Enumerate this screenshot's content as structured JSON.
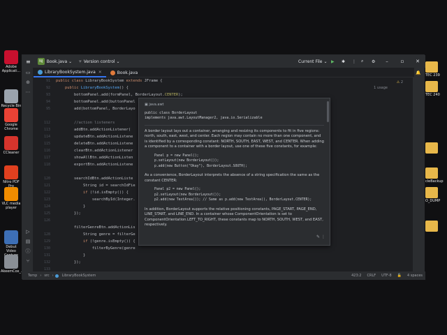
{
  "desktop": {
    "left_icons": [
      {
        "label": "Adobe Applicati...",
        "color": "#c8102e",
        "icon": "adobe-icon"
      },
      {
        "label": "Recycle Bin",
        "color": "#9aa3ad",
        "icon": "recycle-bin-icon"
      },
      {
        "label": "Google Chrome",
        "color": "#e94235",
        "icon": "chrome-icon"
      },
      {
        "label": "CCleaner",
        "color": "#d6342c",
        "icon": "ccleaner-icon"
      },
      {
        "label": "Nitro PDF Pro",
        "color": "#e0401f",
        "icon": "nitro-pdf-icon"
      },
      {
        "label": "VLC media player",
        "color": "#f08c00",
        "icon": "vlc-icon"
      },
      {
        "label": "Debut Video Capture So...",
        "color": "#3d6fb6",
        "icon": "debut-video-icon"
      },
      {
        "label": "AkeemCox_...",
        "color": "#8a8f96",
        "icon": "file-icon"
      }
    ],
    "right_icons": [
      {
        "label": "TEC 239"
      },
      {
        "label": "TEC 240"
      },
      {
        "label": ""
      },
      {
        "label": "cleBackup"
      },
      {
        "label": "O_DUMP"
      },
      {
        "label": ""
      }
    ]
  },
  "ide": {
    "project": "Book.java",
    "project_badge": "NJ",
    "menu_label": "Version control",
    "run_config": "Current File",
    "tabs": [
      {
        "label": "LibraryBookSystem.java",
        "active": true
      },
      {
        "label": "Book.java",
        "active": false
      }
    ],
    "usages_hint": "1 usage",
    "warnings": "2",
    "line_numbers": [
      "91",
      "92",
      "93",
      "94",
      "95",
      "",
      "112",
      "113",
      "114",
      "115",
      "116",
      "117",
      "118",
      "",
      "120",
      "121",
      "122",
      "123",
      "124",
      "125",
      "126",
      "",
      "128",
      "129",
      "130",
      "131",
      "132",
      "133",
      "134",
      "",
      "147"
    ],
    "code_lines": [
      {
        "segments": [
          {
            "t": "public class ",
            "c": "kw"
          },
          {
            "t": "LibraryBookSystem ",
            "c": ""
          },
          {
            "t": "extends ",
            "c": "kw"
          },
          {
            "t": "JFrame {",
            "c": ""
          }
        ]
      },
      {
        "segments": [
          {
            "t": "    public ",
            "c": "kw"
          },
          {
            "t": "LibraryBookSystem",
            "c": "fn"
          },
          {
            "t": "() {",
            "c": ""
          }
        ]
      },
      {
        "segments": [
          {
            "t": "        bottomPanel.add(formPanel, BorderLayout.",
            "c": ""
          },
          {
            "t": "CENTER",
            "c": "ann"
          },
          {
            "t": ");",
            "c": ""
          }
        ]
      },
      {
        "segments": [
          {
            "t": "        bottomPanel.add(buttonPanel",
            "c": ""
          }
        ]
      },
      {
        "segments": [
          {
            "t": "        add(bottomPanel, BorderLayo",
            "c": ""
          }
        ]
      },
      {
        "segments": [
          {
            "t": "",
            "c": ""
          }
        ]
      },
      {
        "segments": [
          {
            "t": "        //action listeners",
            "c": "cm"
          }
        ]
      },
      {
        "segments": [
          {
            "t": "        addBtn.addActionListener(",
            "c": ""
          }
        ]
      },
      {
        "segments": [
          {
            "t": "        updateBtn.addActionListene",
            "c": ""
          }
        ]
      },
      {
        "segments": [
          {
            "t": "        deleteBtn.addActionListene",
            "c": ""
          }
        ]
      },
      {
        "segments": [
          {
            "t": "        clearBtn.addActionListener",
            "c": ""
          }
        ]
      },
      {
        "segments": [
          {
            "t": "        showAllBtn.addActionListen",
            "c": ""
          }
        ]
      },
      {
        "segments": [
          {
            "t": "        exportBtn.addActionListene",
            "c": ""
          }
        ]
      },
      {
        "segments": [
          {
            "t": "",
            "c": ""
          }
        ]
      },
      {
        "segments": [
          {
            "t": "        searchIdBtn.addActionListe",
            "c": ""
          }
        ]
      },
      {
        "segments": [
          {
            "t": "            String id = searchIdFie",
            "c": ""
          }
        ]
      },
      {
        "segments": [
          {
            "t": "            if ",
            "c": "kw"
          },
          {
            "t": "(!id.isEmpty()) {",
            "c": ""
          }
        ]
      },
      {
        "segments": [
          {
            "t": "                searchById(Integer.",
            "c": ""
          }
        ]
      },
      {
        "segments": [
          {
            "t": "            }",
            "c": ""
          }
        ]
      },
      {
        "segments": [
          {
            "t": "        });",
            "c": ""
          }
        ]
      },
      {
        "segments": [
          {
            "t": "",
            "c": ""
          }
        ]
      },
      {
        "segments": [
          {
            "t": "        filterGenreBtn.addActionLis",
            "c": ""
          }
        ]
      },
      {
        "segments": [
          {
            "t": "            String genre = filterGe",
            "c": ""
          }
        ]
      },
      {
        "segments": [
          {
            "t": "            if ",
            "c": "kw"
          },
          {
            "t": "(!genre.isEmpty()) {",
            "c": ""
          }
        ]
      },
      {
        "segments": [
          {
            "t": "                filterByGenre(genre",
            "c": ""
          }
        ]
      },
      {
        "segments": [
          {
            "t": "            }",
            "c": ""
          }
        ]
      },
      {
        "segments": [
          {
            "t": "        });",
            "c": ""
          }
        ]
      },
      {
        "segments": [
          {
            "t": "",
            "c": ""
          }
        ]
      },
      {
        "segments": [
          {
            "t": "",
            "c": ""
          }
        ]
      },
      {
        "segments": [
          {
            "t": "        table.addMouseListener(",
            "c": ""
          },
          {
            "t": "new MouseAdapter() mouseClicked(e) ",
            "c": "hint"
          },
          {
            "t": "{",
            "c": ""
          }
        ]
      }
    ],
    "status": {
      "crumbs": [
        "Temp",
        "src",
        "LibraryBookSystem"
      ],
      "position": "423:2",
      "line_ending": "CRLF",
      "encoding": "UTF-8",
      "indent": "4 spaces"
    }
  },
  "doc_popup": {
    "package": "java.awt",
    "signature_line1": "public class BorderLayout",
    "signature_line2": "implements java.awt.LayoutManager2, java.io.Serializable",
    "para1": "A border layout lays out a container, arranging and resizing its components to fit in five regions: north, south, east, west, and center. Each region may contain no more than one component, and is identified by a corresponding constant: NORTH, SOUTH, EAST, WEST, and CENTER. When adding a component to a container with a border layout, use one of these five constants, for example:",
    "example1": [
      "Panel p = new Panel();",
      "p.setLayout(new BorderLayout());",
      "p.add(new Button(\"Okay\"), BorderLayout.SOUTH);"
    ],
    "para2": "As a convenience, BorderLayout interprets the absence of a string specification the same as the constant CENTER:",
    "example2": [
      "Panel p2 = new Panel();",
      "p2.setLayout(new BorderLayout());",
      "p2.add(new TextArea());  // Same as p.add(new TextArea(), BorderLayout.CENTER);"
    ],
    "para3": "In addition, BorderLayout supports the relative positioning constants, PAGE_START, PAGE_END, LINE_START, and LINE_END. In a container whose ComponentOrientation is set to ComponentOrientation.LEFT_TO_RIGHT, these constants map to NORTH, SOUTH, WEST, and EAST, respectively."
  }
}
